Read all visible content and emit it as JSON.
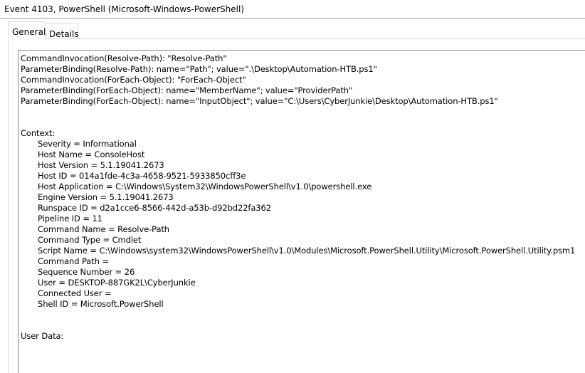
{
  "window": {
    "title": "Event 4103, PowerShell (Microsoft-Windows-PowerShell)"
  },
  "tabs": [
    {
      "label": "General",
      "active": true
    },
    {
      "label": "Details",
      "active": false
    }
  ],
  "event_text": {
    "payload_lines": [
      "CommandInvocation(Resolve-Path): \"Resolve-Path\"",
      "ParameterBinding(Resolve-Path): name=\"Path\"; value=\".\\Desktop\\Automation-HTB.ps1\"",
      "CommandInvocation(ForEach-Object): \"ForEach-Object\"",
      "ParameterBinding(ForEach-Object): name=\"MemberName\"; value=\"ProviderPath\"",
      "ParameterBinding(ForEach-Object): name=\"InputObject\"; value=\"C:\\Users\\CyberJunkie\\Desktop\\Automation-HTB.ps1\""
    ],
    "context_label": "Context:",
    "context_lines": [
      "Severity = Informational",
      "Host Name = ConsoleHost",
      "Host Version = 5.1.19041.2673",
      "Host ID = 014a1fde-4c3a-4658-9521-5933850cff3e",
      "Host Application = C:\\Windows\\System32\\WindowsPowerShell\\v1.0\\powershell.exe",
      "Engine Version = 5.1.19041.2673",
      "Runspace ID = d2a1cce6-8566-442d-a53b-d92bd22fa362",
      "Pipeline ID = 11",
      "Command Name = Resolve-Path",
      "Command Type = Cmdlet",
      "Script Name = C:\\Windows\\system32\\WindowsPowerShell\\v1.0\\Modules\\Microsoft.PowerShell.Utility\\Microsoft.PowerShell.Utility.psm1",
      "Command Path =",
      "Sequence Number = 26",
      "User = DESKTOP-887GK2L\\CyberJunkie",
      "Connected User =",
      "Shell ID = Microsoft.PowerShell"
    ],
    "user_data_label": "User Data:"
  }
}
